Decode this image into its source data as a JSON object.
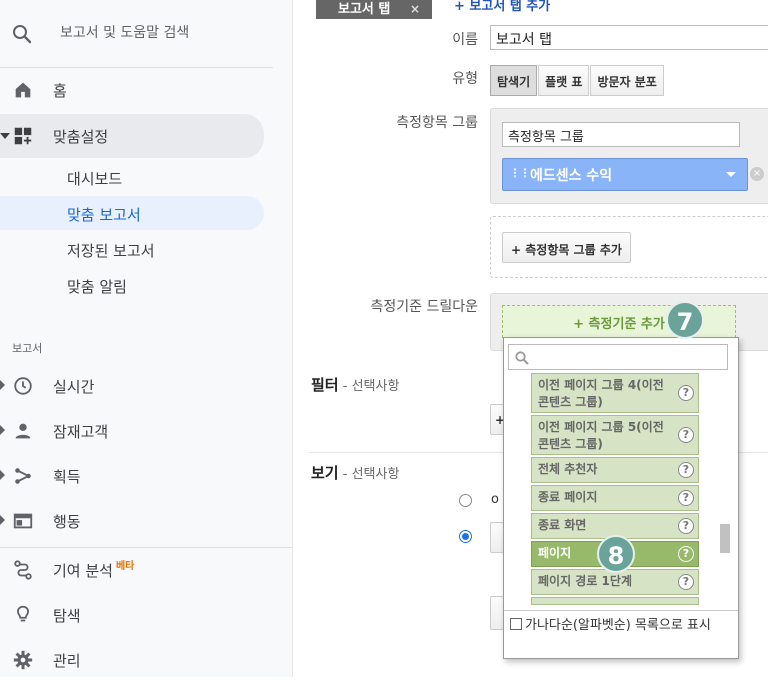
{
  "sidebar": {
    "search_label": "보고서 및 도움말 검색",
    "home_label": "홈",
    "customization_label": "맞춤설정",
    "sub_items": [
      "대시보드",
      "맞춤 보고서",
      "저장된 보고서",
      "맞춤 알림"
    ],
    "reports_header": "보고서",
    "reports": [
      "실시간",
      "잠재고객",
      "획득",
      "행동"
    ],
    "attribution_label": "기여 분석",
    "beta_badge": "베타",
    "discover_label": "탐색",
    "admin_label": "관리"
  },
  "main": {
    "report_tab_label": "보고서 탭",
    "report_tab_close": "×",
    "add_tab_link": "+ 보고서 탭 추가",
    "name_label": "이름",
    "name_value": "보고서 탭",
    "type_label": "유형",
    "type_options": [
      "탐색기",
      "플랫 표",
      "방문자 분포"
    ],
    "metric_group_label": "측정항목 그룹",
    "metric_group_name": "측정항목 그룹",
    "metric_pill": "에드센스 수익",
    "add_metric_group_btn": "+ 측정항목 그룹 추가",
    "dimension_label": "측정기준 드릴다운",
    "add_dimension": "+ 측정기준 추가",
    "filter_title": "필터",
    "filter_optional": " - 선택사항",
    "view_title": "보기",
    "view_optional": " - 선택사항",
    "peek_filter_btn": "+",
    "peek_radio_1": "o"
  },
  "dropdown": {
    "items": [
      "이전 페이지 그룹 4(이전 콘텐츠 그룹)",
      "이전 페이지 그룹 5(이전 콘텐츠 그룹)",
      "전체 추천자",
      "종료 페이지",
      "종료 화면",
      "페이지",
      "페이지 경로 1단계"
    ],
    "help_glyph": "?",
    "footer_text": "가나다순(알파벳순) 목록으로 표시",
    "footer_checked": false
  },
  "annotations": {
    "badge_7": "7",
    "badge_8": "8"
  }
}
